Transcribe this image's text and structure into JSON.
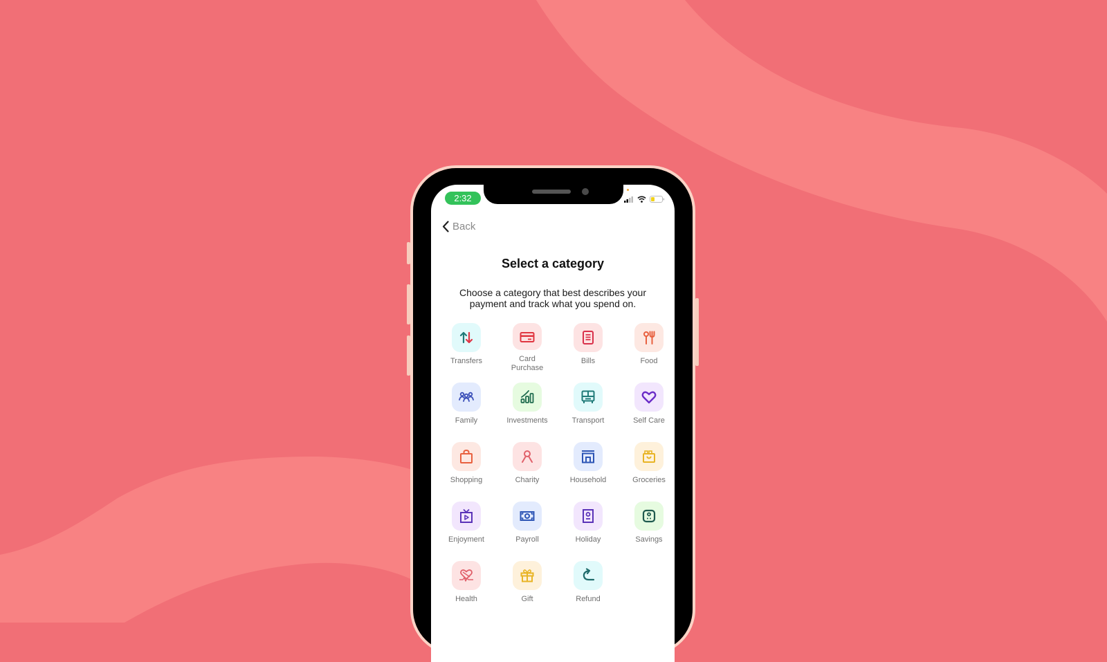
{
  "colors": {
    "background": "#f16f76",
    "background_wave": "#f88283",
    "phone_frame": "#000000",
    "phone_bezel": "#fbd3c6",
    "time_pill": "#33c25a"
  },
  "status_bar": {
    "time": "2:32",
    "icons": [
      "signal-icon",
      "wifi-icon",
      "battery-low-icon"
    ]
  },
  "nav": {
    "back_label": "Back",
    "back_icon": "chevron-left-icon"
  },
  "header": {
    "title": "Select a category",
    "subtitle": "Choose a category that best describes your payment and track what you spend on."
  },
  "categories": [
    {
      "label": "Transfers",
      "icon": "transfer-arrows-icon",
      "bg": "#e1fafb",
      "fg": "#1f7a78",
      "fg2": "#e03545"
    },
    {
      "label": "Card Purchase",
      "icon": "credit-card-icon",
      "bg": "#fde3e3",
      "fg": "#e0353f"
    },
    {
      "label": "Bills",
      "icon": "bill-document-icon",
      "bg": "#fde3e3",
      "fg": "#d9304a"
    },
    {
      "label": "Food",
      "icon": "cutlery-icon",
      "bg": "#fde8e2",
      "fg": "#e8603f"
    },
    {
      "label": "Family",
      "icon": "family-icon",
      "bg": "#e3ebfd",
      "fg": "#3a4fb8"
    },
    {
      "label": "Investments",
      "icon": "chart-growth-icon",
      "bg": "#e6fbe0",
      "fg": "#1f6b4e"
    },
    {
      "label": "Transport",
      "icon": "bus-icon",
      "bg": "#e1fafb",
      "fg": "#1f7a78"
    },
    {
      "label": "Self Care",
      "icon": "heart-icon",
      "bg": "#f2e6fd",
      "fg": "#6a2bc7"
    },
    {
      "label": "Shopping",
      "icon": "shopping-bag-icon",
      "bg": "#fde8e2",
      "fg": "#e8603f"
    },
    {
      "label": "Charity",
      "icon": "ribbon-icon",
      "bg": "#fde3e3",
      "fg": "#e0606a"
    },
    {
      "label": "Household",
      "icon": "store-icon",
      "bg": "#e3ebfd",
      "fg": "#2d55b5"
    },
    {
      "label": "Groceries",
      "icon": "grocery-basket-icon",
      "bg": "#fef1db",
      "fg": "#e8b425"
    },
    {
      "label": "Enjoyment",
      "icon": "tv-play-icon",
      "bg": "#f2e6fd",
      "fg": "#5a33b8"
    },
    {
      "label": "Payroll",
      "icon": "money-icon",
      "bg": "#e3ebfd",
      "fg": "#2d55b5"
    },
    {
      "label": "Holiday",
      "icon": "passport-icon",
      "bg": "#f2e6fd",
      "fg": "#5a33b8"
    },
    {
      "label": "Savings",
      "icon": "safe-icon",
      "bg": "#e6fbe0",
      "fg": "#1f5a4e"
    },
    {
      "label": "Health",
      "icon": "health-heart-icon",
      "bg": "#fde3e3",
      "fg": "#e0606a"
    },
    {
      "label": "Gift",
      "icon": "gift-icon",
      "bg": "#fef1db",
      "fg": "#e8b425"
    },
    {
      "label": "Refund",
      "icon": "refund-arrow-icon",
      "bg": "#e1fafb",
      "fg": "#1f6b6b"
    }
  ]
}
